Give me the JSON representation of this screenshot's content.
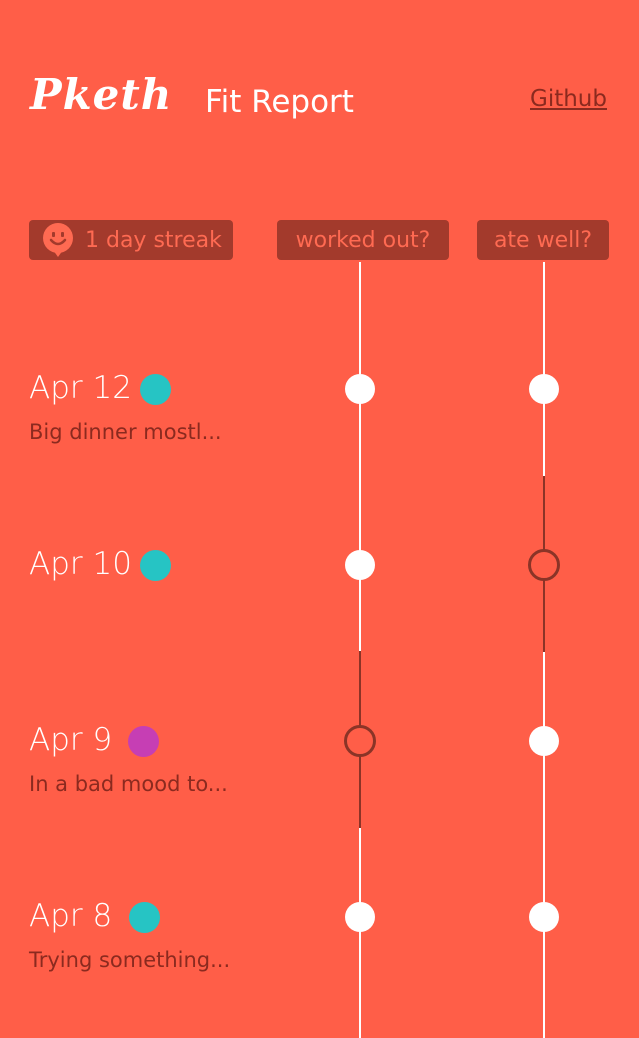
{
  "header": {
    "logo_text": "Pketh",
    "title": "Fit Report",
    "github_label": "Github"
  },
  "columns": {
    "streak_label": "1 day streak",
    "worked_out_label": "worked out?",
    "ate_well_label": "ate well?"
  },
  "colors": {
    "background": "#FF5E48",
    "chip": "#A33A2C",
    "mood_good": "#26C4C4",
    "mood_bad": "#C63EB4"
  },
  "entries": [
    {
      "date": "Apr 12",
      "mood": "good",
      "note": "Big dinner mostl...",
      "worked_out": true,
      "ate_well": true
    },
    {
      "date": "Apr 10",
      "mood": "good",
      "note": "",
      "worked_out": true,
      "ate_well": false
    },
    {
      "date": "Apr 9",
      "mood": "bad",
      "note": "In a bad mood to...",
      "worked_out": false,
      "ate_well": true
    },
    {
      "date": "Apr 8",
      "mood": "good",
      "note": "Trying something...",
      "worked_out": true,
      "ate_well": true
    }
  ]
}
